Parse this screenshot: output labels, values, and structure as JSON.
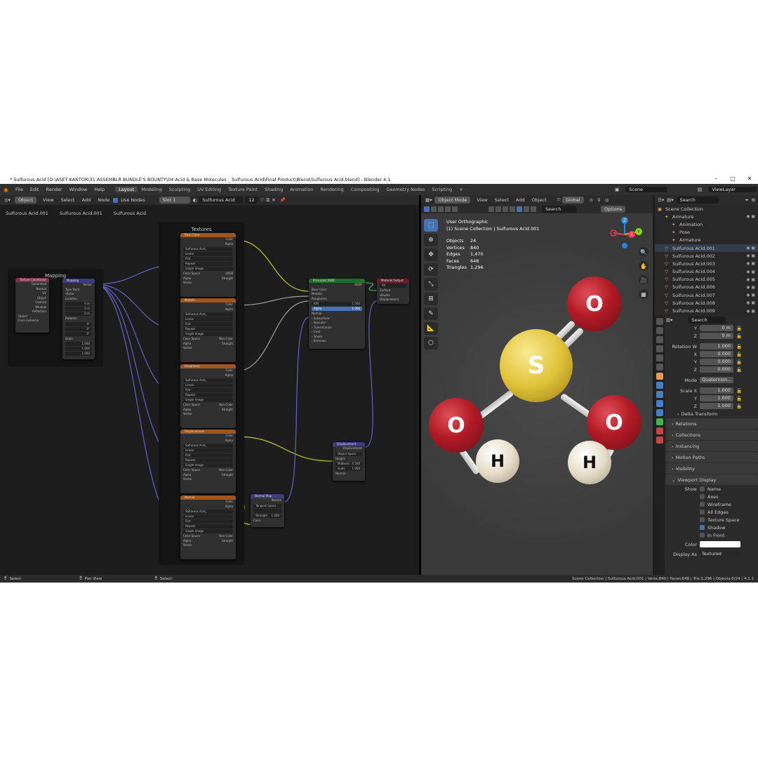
{
  "title_bar": {
    "title": "* Sulfurous Acid [D:\\ASET KANTOR\\31 ASSEMBLR BUNDLE'S BOUNTY\\04 Acid & Base Molecules _ Sulfurous Acid\\Final Product\\Blend\\Sulfurous Acid.blend] - Blender 4.1"
  },
  "menu": [
    "File",
    "Edit",
    "Render",
    "Window",
    "Help"
  ],
  "workspaces": [
    "Layout",
    "Modeling",
    "Sculpting",
    "UV Editing",
    "Texture Paint",
    "Shading",
    "Animation",
    "Rendering",
    "Compositing",
    "Geometry Nodes",
    "Scripting"
  ],
  "active_workspace": "Layout",
  "scene": "Scene",
  "view_layer": "ViewLayer",
  "node_header": {
    "mode": "Object",
    "menus": [
      "View",
      "Select",
      "Add",
      "Node"
    ],
    "use_nodes": "Use Nodes",
    "slot": "Slot 1",
    "material": "Sulfurous Acid",
    "users": "12"
  },
  "breadcrumb": [
    "Sulfurous Acid.001",
    "Sulfurous Acid.001",
    "Sulfurous Acid"
  ],
  "frames": {
    "mapping": "Mapping",
    "textures": "Textures"
  },
  "nodes": {
    "texcoord": {
      "title": "Texture Coordinate",
      "outputs": [
        "Generated",
        "Normal",
        "UV",
        "Object",
        "Camera",
        "Window",
        "Reflection"
      ],
      "object": "Object",
      "from_instancer": "From Instancer"
    },
    "mapping": {
      "title": "Mapping",
      "out": "Vector",
      "type_label": "Type",
      "type": "Point",
      "vector": "Vector",
      "location": "Location",
      "rotation": "Rotation",
      "scale": "Scale",
      "loc": [
        "0 m",
        "0 m",
        "0 m"
      ],
      "rot": [
        "0°",
        "0°",
        "0°"
      ],
      "scl": [
        "1.000",
        "1.000",
        "1.000"
      ]
    },
    "textures": [
      {
        "title": "Base Color",
        "color_space": "sRGB"
      },
      {
        "title": "Metallic",
        "color_space": "Non-Color"
      },
      {
        "title": "Roughness",
        "color_space": "Non-Color"
      },
      {
        "title": "Displacement",
        "color_space": "Non-Color"
      },
      {
        "title": "Normal",
        "color_space": "Non-Color"
      }
    ],
    "tex_common": {
      "color": "Color",
      "alpha": "Alpha",
      "image": "Sulfurous Acid_",
      "interp": "Linear",
      "proj": "Flat",
      "ext": "Repeat",
      "src": "Single Image",
      "cs_label": "Color Space",
      "alpha_label": "Alpha",
      "alpha_val": "Straight",
      "vector": "Vector"
    },
    "bsdf": {
      "title": "Principled BSDF",
      "out": "BSDF",
      "inputs": [
        "Base Color",
        "Metallic",
        "Roughness"
      ],
      "ior_label": "IOR",
      "ior": "1.500",
      "alpha_label": "Alpha",
      "alpha": "1.000",
      "normal": "Normal",
      "panels": [
        "Subsurface",
        "Specular",
        "Transmission",
        "Coat",
        "Sheen",
        "Emission"
      ]
    },
    "output": {
      "title": "Material Output",
      "target": "All",
      "inputs": [
        "Surface",
        "Volume",
        "Displacement"
      ]
    },
    "displacement": {
      "title": "Displacement",
      "out": "Displacement",
      "space": "Object Space",
      "height": "Height",
      "midlevel_label": "Midlevel",
      "midlevel": "0.500",
      "scale_label": "Scale",
      "scale": "1.000",
      "normal": "Normal"
    },
    "normalmap": {
      "title": "Normal Map",
      "out": "Normal",
      "space": "Tangent Space",
      "strength_label": "Strength",
      "strength": "1.000",
      "color": "Color"
    }
  },
  "viewport_header": {
    "mode": "Object Mode",
    "menus": [
      "View",
      "Select",
      "Add",
      "Object"
    ],
    "orientation": "Global",
    "search": "Search",
    "options": "Options"
  },
  "viewport": {
    "view_name": "User Orthographic",
    "collection": "(1) Scene Collection | Sulfurous Acid.001",
    "stats": [
      [
        "Objects",
        "24"
      ],
      [
        "Vertices",
        "840"
      ],
      [
        "Edges",
        "1,470"
      ],
      [
        "Faces",
        "648"
      ],
      [
        "Triangles",
        "1,296"
      ]
    ],
    "atoms": {
      "o_top": "O",
      "s": "S",
      "o_left": "O",
      "o_right": "O",
      "h_left": "H",
      "h_right": "H"
    },
    "gizmo": {
      "x": "X",
      "y": "Y",
      "z": "Z"
    }
  },
  "outliner": {
    "search": "Search",
    "items": [
      {
        "label": "Scene Collection",
        "indent": 0
      },
      {
        "label": "Armature",
        "indent": 1
      },
      {
        "label": "Animation",
        "indent": 2
      },
      {
        "label": "Pose",
        "indent": 2
      },
      {
        "label": "Armature",
        "indent": 2
      },
      {
        "label": "Sulfurous Acid.001",
        "indent": 1
      },
      {
        "label": "Sulfurous Acid.002",
        "indent": 1
      },
      {
        "label": "Sulfurous Acid.003",
        "indent": 1
      },
      {
        "label": "Sulfurous Acid.004",
        "indent": 1
      },
      {
        "label": "Sulfurous Acid.005",
        "indent": 1
      },
      {
        "label": "Sulfurous Acid.006",
        "indent": 1
      },
      {
        "label": "Sulfurous Acid.007",
        "indent": 1
      },
      {
        "label": "Sulfurous Acid.008",
        "indent": 1
      },
      {
        "label": "Sulfurous Acid.009",
        "indent": 1
      }
    ]
  },
  "properties": {
    "search": "Search",
    "rows": [
      [
        "Y",
        "0 m"
      ],
      [
        "Z",
        "0 m"
      ]
    ],
    "rotation_w_label": "Rotation W",
    "rotation_w": "1.000",
    "rot_rows": [
      [
        "X",
        "0.000"
      ],
      [
        "Y",
        "0.000"
      ],
      [
        "Z",
        "0.000"
      ]
    ],
    "mode_label": "Mode",
    "mode": "Quaternion...",
    "scale_label": "Scale X",
    "scale_x": "1.000",
    "scale_rows": [
      [
        "Y",
        "1.000"
      ],
      [
        "Z",
        "1.000"
      ]
    ],
    "delta": "Delta Transform",
    "sections": [
      "Relations",
      "Collections",
      "Instancing",
      "Motion Paths",
      "Visibility"
    ],
    "viewport_display": "Viewport Display",
    "show_label": "Show",
    "show_items": [
      {
        "label": "Name",
        "checked": false
      },
      {
        "label": "Axes",
        "checked": false
      },
      {
        "label": "Wireframe",
        "checked": false
      },
      {
        "label": "All Edges",
        "checked": false
      },
      {
        "label": "Texture Space",
        "checked": false
      },
      {
        "label": "Shadow",
        "checked": true
      },
      {
        "label": "In Front",
        "checked": false
      }
    ],
    "color_label": "Color",
    "display_as_label": "Display As",
    "display_as": "Textured"
  },
  "status_bar": {
    "left": [
      "Select",
      "Pan View",
      "Select"
    ],
    "right": "Scene Collection | Sulfurous Acid.001 | Verts:840 | Faces:648 | Tris:1,296 | Objects:0/24 | 4.1.1"
  }
}
